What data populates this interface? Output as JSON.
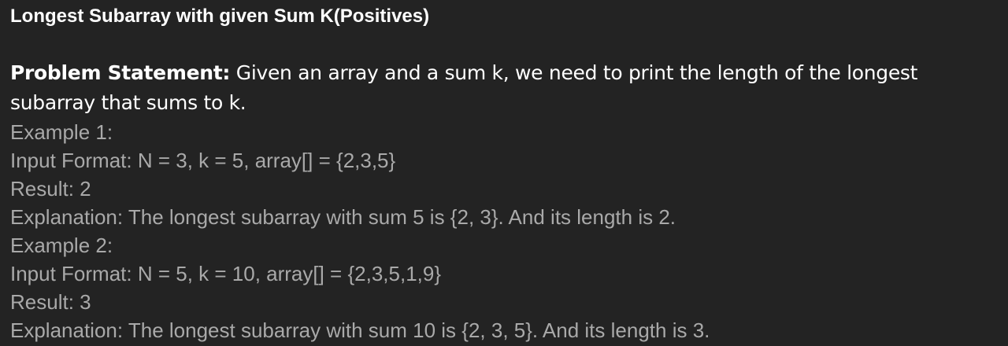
{
  "title": "Longest Subarray with given Sum K(Positives)",
  "statement": {
    "label": "Problem Statement:",
    "text": " Given an array and a sum k, we need to print the length of the longest subarray that sums to k."
  },
  "examples": [
    {
      "heading": "Example 1:",
      "input": "Input Format: N = 3, k = 5, array[] = {2,3,5}",
      "result": "Result: 2",
      "explanation": "Explanation: The longest subarray with sum 5 is {2, 3}. And its length is 2."
    },
    {
      "heading": "Example 2:",
      "input": "Input Format: N = 5, k = 10, array[] = {2,3,5,1,9}",
      "result": "Result: 3",
      "explanation": "Explanation: The longest subarray with sum 10 is {2, 3, 5}. And its length is 3."
    }
  ],
  "colors": {
    "background": "#232323",
    "primary_text": "#ffffff",
    "secondary_text": "#a9a9a9"
  }
}
